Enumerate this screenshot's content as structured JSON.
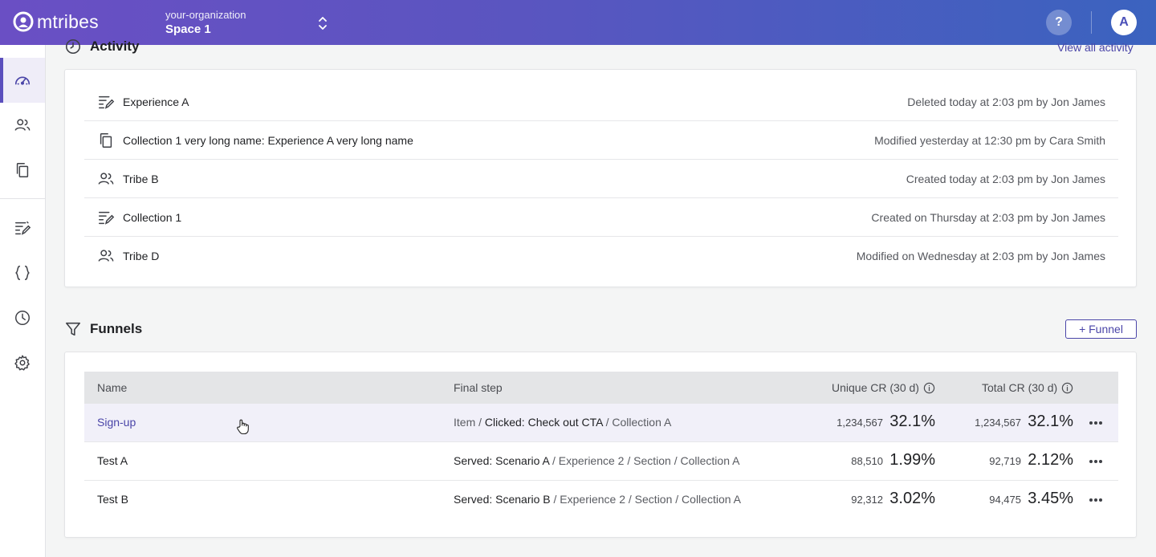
{
  "app": {
    "brand": "mtribes"
  },
  "header": {
    "org_name": "your-organization",
    "space_name": "Space 1",
    "help_label": "?",
    "avatar_initial": "A"
  },
  "sidebar": {
    "items": [
      {
        "icon": "dashboard-icon",
        "active": true
      },
      {
        "icon": "tribes-icon",
        "active": false
      },
      {
        "icon": "collections-icon",
        "active": false
      },
      {
        "icon": "experiences-icon",
        "active": false
      },
      {
        "icon": "code-icon",
        "active": false
      },
      {
        "icon": "history-icon",
        "active": false
      },
      {
        "icon": "settings-icon",
        "active": false
      }
    ]
  },
  "activity": {
    "title": "Activity",
    "view_all_label": "View all activity",
    "rows": [
      {
        "icon": "experience-icon",
        "name": "Experience A",
        "meta": "Deleted today at 2:03 pm by Jon James"
      },
      {
        "icon": "collection-icon",
        "name": "Collection 1 very long name: Experience A very long name",
        "meta": "Modified yesterday at 12:30 pm by Cara Smith"
      },
      {
        "icon": "tribe-icon",
        "name": "Tribe B",
        "meta": "Created today at 2:03 pm by Jon James"
      },
      {
        "icon": "experience-icon",
        "name": "Collection 1",
        "meta": "Created on Thursday at 2:03 pm by Jon James"
      },
      {
        "icon": "tribe-icon",
        "name": "Tribe D",
        "meta": "Modified on Wednesday at 2:03 pm by Jon James"
      }
    ]
  },
  "funnels": {
    "title": "Funnels",
    "add_label": "+ Funnel",
    "columns": {
      "name": "Name",
      "final_step": "Final step",
      "unique_cr": "Unique CR (30 d)",
      "total_cr": "Total CR (30 d)"
    },
    "rows": [
      {
        "name": "Sign-up",
        "step_prefix": "Item",
        "step_main": "Clicked: Check out CTA",
        "step_rest": "Collection A",
        "unique_count": "1,234,567",
        "unique_pct": "32.1%",
        "total_count": "1,234,567",
        "total_pct": "32.1%"
      },
      {
        "name": "Test A",
        "step_main": "Served: Scenario A",
        "step_rest": "Experience 2 / Section / Collection A",
        "unique_count": "88,510",
        "unique_pct": "1.99%",
        "total_count": "92,719",
        "total_pct": "2.12%"
      },
      {
        "name": "Test B",
        "step_main": "Served: Scenario B",
        "step_rest": "Experience 2 / Section / Collection A",
        "unique_count": "92,312",
        "unique_pct": "3.02%",
        "total_count": "94,475",
        "total_pct": "3.45%"
      }
    ]
  },
  "colors": {
    "accent": "#4a45a8",
    "header_start": "#6a4fc4",
    "header_end": "#3b63bf"
  }
}
